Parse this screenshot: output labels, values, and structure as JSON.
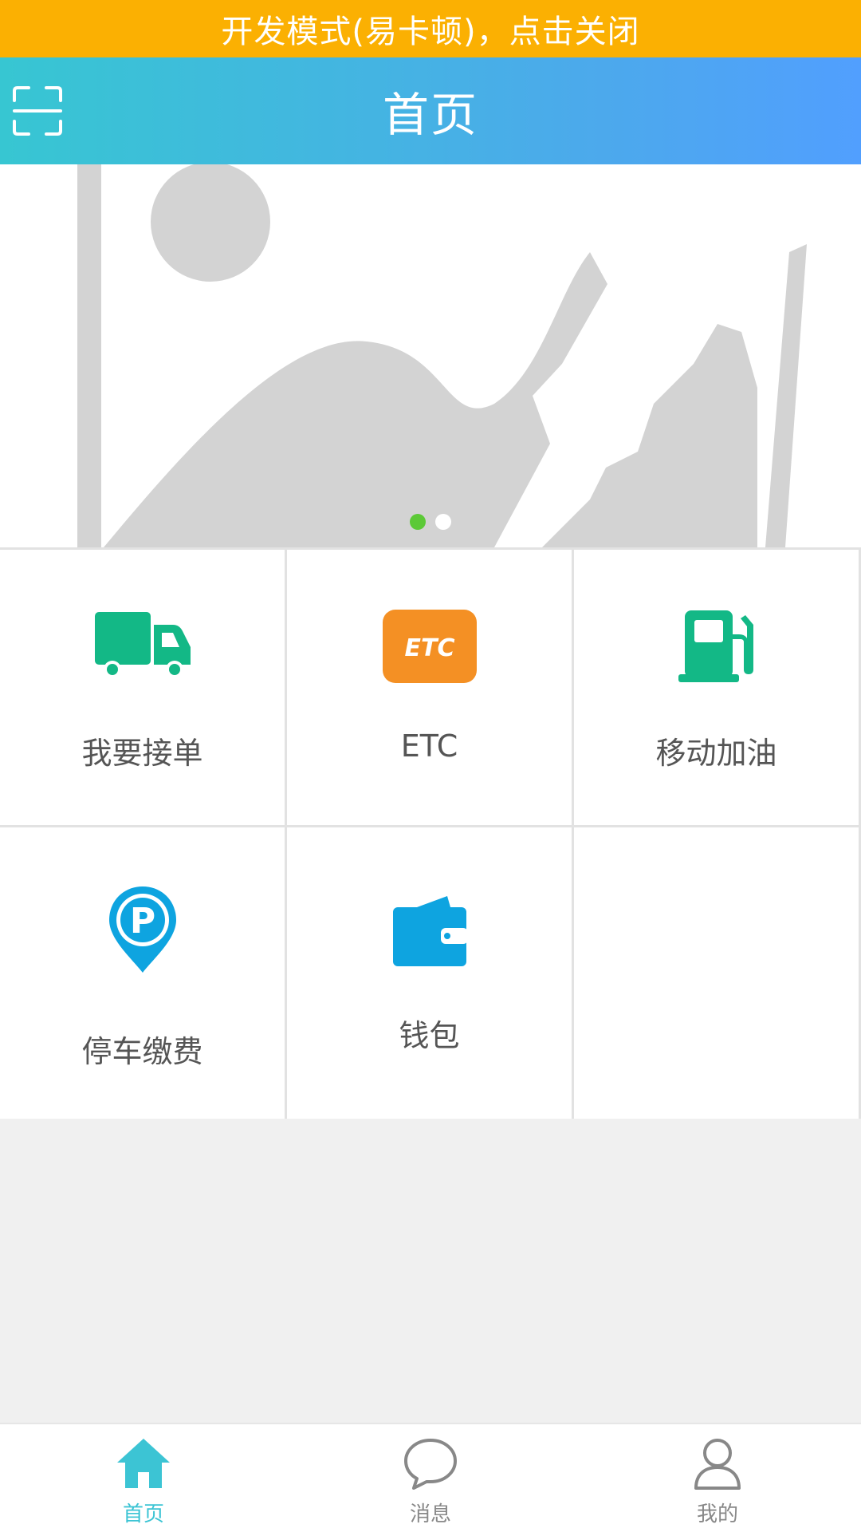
{
  "dev_banner": {
    "text": "开发模式(易卡顿)，点击关闭"
  },
  "header": {
    "title": "首页",
    "scan_icon": "scan-icon"
  },
  "carousel": {
    "image_icon": "image-placeholder-icon",
    "slide_count": 2,
    "active_index": 0,
    "active_dot_color": "#5cc937"
  },
  "services": [
    {
      "label": "我要接单",
      "icon": "truck-icon",
      "color": "#13b886"
    },
    {
      "label": "ETC",
      "icon": "etc-icon",
      "color": "#f49024"
    },
    {
      "label": "移动加油",
      "icon": "fuel-pump-icon",
      "color": "#13b886"
    },
    {
      "label": "停车缴费",
      "icon": "parking-pin-icon",
      "color": "#0ea4e0"
    },
    {
      "label": "钱包",
      "icon": "wallet-icon",
      "color": "#0ea4e0"
    }
  ],
  "tabbar": {
    "items": [
      {
        "label": "首页",
        "icon": "home-icon",
        "active": true
      },
      {
        "label": "消息",
        "icon": "chat-bubble-icon",
        "active": false
      },
      {
        "label": "我的",
        "icon": "user-icon",
        "active": false
      }
    ],
    "active_color": "#3cc4d4",
    "inactive_color": "#888888"
  },
  "colors": {
    "banner_bg": "#fbb002",
    "header_gradient_start": "#37c6d2",
    "header_gradient_end": "#519ffe"
  }
}
